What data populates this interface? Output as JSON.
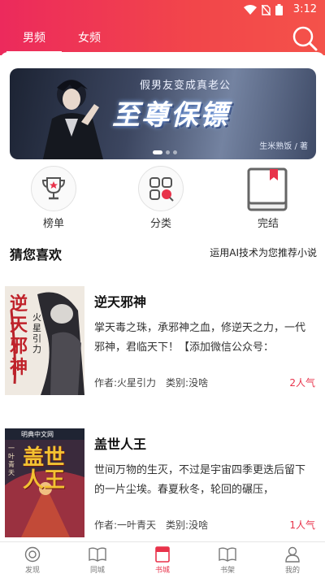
{
  "status": {
    "time": "3:12"
  },
  "tabs": [
    {
      "label": "男频"
    },
    {
      "label": "女频"
    }
  ],
  "banner": {
    "subtitle": "假男友变成真老公",
    "title": "至尊保镖",
    "author": "生米熟饭 / 著",
    "page_count": 3,
    "active_page": 1
  },
  "quick_nav": [
    {
      "label": "榜单",
      "icon": "trophy-icon"
    },
    {
      "label": "分类",
      "icon": "category-icon"
    },
    {
      "label": "完结",
      "icon": "book-complete-icon"
    }
  ],
  "section": {
    "title": "猜您喜欢",
    "note": "运用AI技术为您推荐小说"
  },
  "books": [
    {
      "title": "逆天邪神",
      "desc": "掌天毒之珠，承邪神之血，修逆天之力，一代邪神，君临天下！【添加微信公众号：",
      "author": "作者:火星引力",
      "category": "类别:没啥",
      "popularity": "2人气",
      "cover_text": "逆天邪神",
      "cover_author": "火星引力"
    },
    {
      "title": "盖世人王",
      "desc": "世间万物的生灭，不过是宇宙四季更迭后留下的一片尘埃。春夏秋冬，轮回的碾压，",
      "author": "作者:一叶青天",
      "category": "类别:没啥",
      "popularity": "1人气",
      "cover_text": "盖世人王",
      "cover_author": "一叶青天",
      "cover_brand": "明典中文网"
    }
  ],
  "bottom_nav": [
    {
      "label": "发现",
      "icon": "discover-icon"
    },
    {
      "label": "同城",
      "icon": "local-icon"
    },
    {
      "label": "书城",
      "icon": "bookstore-icon"
    },
    {
      "label": "书架",
      "icon": "bookshelf-icon"
    },
    {
      "label": "我的",
      "icon": "profile-icon"
    }
  ],
  "colors": {
    "accent": "#e8324a",
    "header_start": "#ec2a5c",
    "header_end": "#f4524a"
  }
}
